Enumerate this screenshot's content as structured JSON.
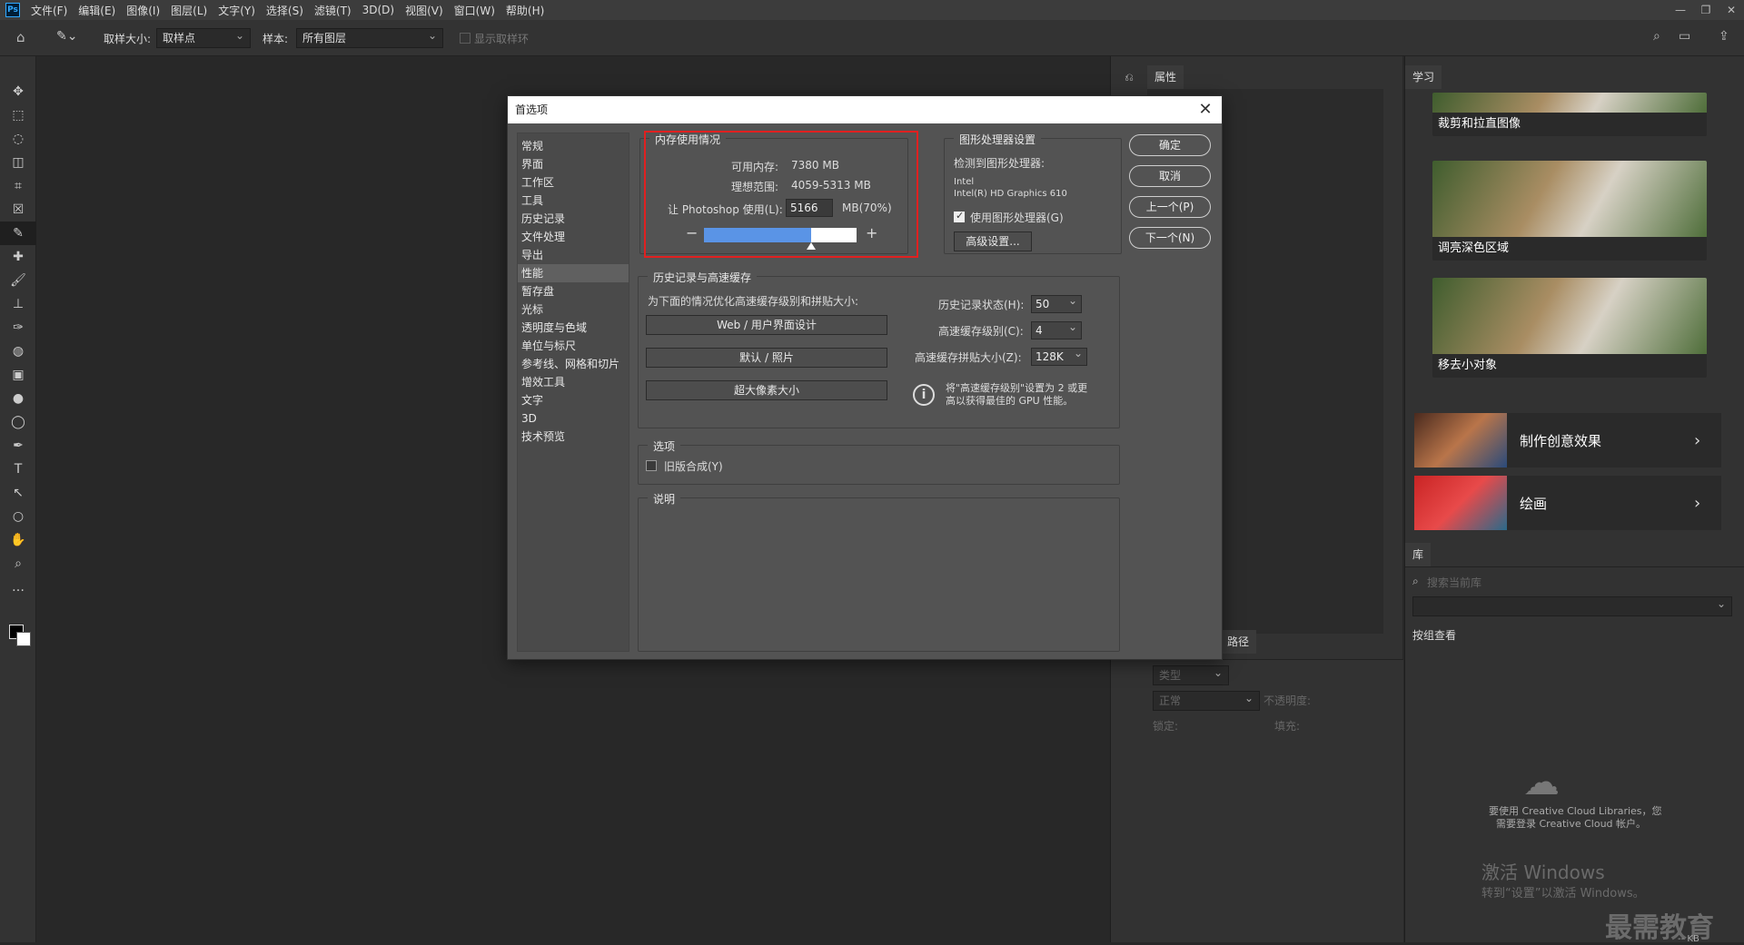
{
  "app": {
    "logo": "Ps"
  },
  "menu": [
    "文件(F)",
    "编辑(E)",
    "图像(I)",
    "图层(L)",
    "文字(Y)",
    "选择(S)",
    "滤镜(T)",
    "3D(D)",
    "视图(V)",
    "窗口(W)",
    "帮助(H)"
  ],
  "window_controls": [
    "—",
    "❐",
    "✕"
  ],
  "options": {
    "sample_size_label": "取样大小:",
    "sample_size_value": "取样点",
    "sample_label": "样本:",
    "sample_value": "所有图层",
    "show_ring_label": "显示取样环"
  },
  "tools": [
    "✥",
    "⬚",
    "◌",
    "◫",
    "⌗",
    "☒",
    "✎",
    "✚",
    "🖌",
    "⊥",
    "✑",
    "◍",
    "▣",
    "●",
    "◯",
    "✒",
    "T",
    "↖",
    "○",
    "✋",
    "⌕",
    "…"
  ],
  "mid_panel": {
    "tab_properties": "属性",
    "tab_paths": "路径",
    "layers": {
      "filter_placeholder": "类型",
      "blend_mode": "正常",
      "opacity_label": "不透明度:",
      "lock_label": "锁定:",
      "fill_label": "填充:"
    }
  },
  "learn_panel": {
    "tab": "学习",
    "cards": [
      "裁剪和拉直图像",
      "调亮深色区域",
      "移去小对象"
    ],
    "big_cards": [
      "制作创意效果",
      "绘画"
    ]
  },
  "library_panel": {
    "tab": "库",
    "search_placeholder": "搜索当前库",
    "view_label": "按组查看",
    "message_line1": "要使用 Creative Cloud Libraries，您",
    "message_line2": "需要登录 Creative Cloud 帐户。",
    "status": "-- KB"
  },
  "watermark": {
    "activate_line1": "激活 Windows",
    "activate_line2": "转到“设置”以激活 Windows。",
    "brand": "最需教育"
  },
  "dialog": {
    "title": "首选项",
    "close": "✕",
    "categories": [
      "常规",
      "界面",
      "工作区",
      "工具",
      "历史记录",
      "文件处理",
      "导出",
      "性能",
      "暂存盘",
      "光标",
      "透明度与色域",
      "单位与标尺",
      "参考线、网格和切片",
      "增效工具",
      "文字",
      "3D",
      "技术预览"
    ],
    "active_category": "性能",
    "memory": {
      "title": "内存使用情况",
      "available_label": "可用内存:",
      "available_value": "7380 MB",
      "ideal_label": "理想范围:",
      "ideal_value": "4059-5313 MB",
      "use_label": "让 Photoshop 使用(L):",
      "use_value": "5166",
      "use_unit": "MB(70%)",
      "slider_percent": 70,
      "minus": "−",
      "plus": "+"
    },
    "gpu": {
      "title": "图形处理器设置",
      "detected_label": "检测到图形处理器:",
      "vendor": "Intel",
      "model": "Intel(R) HD Graphics 610",
      "use_gpu_label": "使用图形处理器(G)",
      "use_gpu_checked": true,
      "advanced_button": "高级设置..."
    },
    "buttons": {
      "ok": "确定",
      "cancel": "取消",
      "prev": "上一个(P)",
      "next": "下一个(N)"
    },
    "history": {
      "title": "历史记录与高速缓存",
      "optimize_label": "为下面的情况优化高速缓存级别和拼贴大小:",
      "preset_buttons": [
        "Web / 用户界面设计",
        "默认 / 照片",
        "超大像素大小"
      ],
      "states_label": "历史记录状态(H):",
      "states_value": "50",
      "levels_label": "高速缓存级别(C):",
      "levels_value": "4",
      "tile_label": "高速缓存拼贴大小(Z):",
      "tile_value": "128K",
      "info_line1": "将\"高速缓存级别\"设置为 2 或更",
      "info_line2": "高以获得最佳的 GPU 性能。"
    },
    "options": {
      "title": "选项",
      "legacy_label": "旧版合成(Y)",
      "legacy_checked": false
    },
    "description": {
      "title": "说明"
    }
  }
}
